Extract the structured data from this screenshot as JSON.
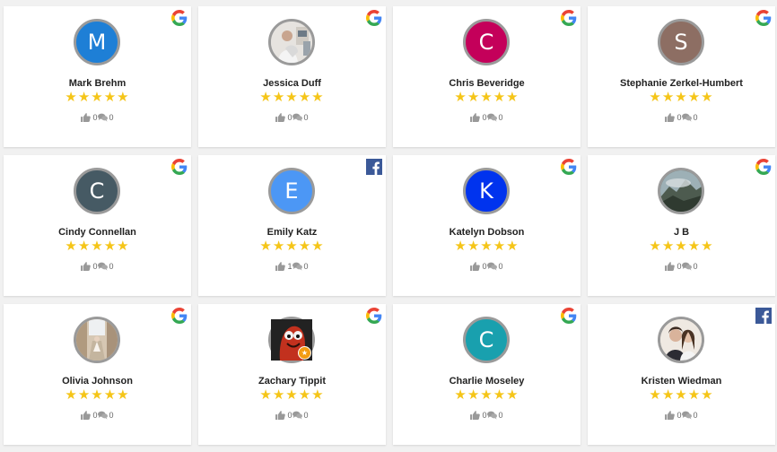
{
  "reviews": [
    {
      "name": "Mark Brehm",
      "initial": "M",
      "avatar_color": "#1e7fd6",
      "avatar_type": "letter",
      "source": "google",
      "likes": "0",
      "comments": "0"
    },
    {
      "name": "Jessica Duff",
      "initial": "",
      "avatar_color": "#c9c9c9",
      "avatar_type": "photo-room",
      "source": "google",
      "likes": "0",
      "comments": "0"
    },
    {
      "name": "Chris Beveridge",
      "initial": "C",
      "avatar_color": "#c4005a",
      "avatar_type": "letter",
      "source": "google",
      "likes": "0",
      "comments": "0"
    },
    {
      "name": "Stephanie Zerkel-Humbert",
      "initial": "S",
      "avatar_color": "#8d6e63",
      "avatar_type": "letter",
      "source": "google",
      "likes": "0",
      "comments": "0"
    },
    {
      "name": "Cindy Connellan",
      "initial": "C",
      "avatar_color": "#465a64",
      "avatar_type": "letter",
      "source": "google",
      "likes": "0",
      "comments": "0"
    },
    {
      "name": "Emily Katz",
      "initial": "E",
      "avatar_color": "#4c97f5",
      "avatar_type": "letter",
      "source": "facebook",
      "likes": "1",
      "comments": "0"
    },
    {
      "name": "Katelyn Dobson",
      "initial": "K",
      "avatar_color": "#0033ee",
      "avatar_type": "letter",
      "source": "google",
      "likes": "0",
      "comments": "0"
    },
    {
      "name": "J B",
      "initial": "",
      "avatar_color": "#5f6d63",
      "avatar_type": "photo-mountain",
      "source": "google",
      "likes": "0",
      "comments": "0"
    },
    {
      "name": "Olivia Johnson",
      "initial": "",
      "avatar_color": "#c8b6a0",
      "avatar_type": "photo-street",
      "source": "google",
      "likes": "0",
      "comments": "0"
    },
    {
      "name": "Zachary Tippit",
      "initial": "",
      "avatar_color": "#b32418",
      "avatar_type": "photo-muppet",
      "source": "google",
      "likes": "0",
      "comments": "0"
    },
    {
      "name": "Charlie Moseley",
      "initial": "C",
      "avatar_color": "#19a0ae",
      "avatar_type": "letter",
      "source": "google",
      "likes": "0",
      "comments": "0"
    },
    {
      "name": "Kristen Wiedman",
      "initial": "",
      "avatar_color": "#d8cfc4",
      "avatar_type": "photo-couple",
      "source": "facebook",
      "likes": "0",
      "comments": "0"
    }
  ],
  "rating_stars": "★★★★★",
  "colors": {
    "star": "#f5c518",
    "facebook": "#3b5998",
    "border": "#9a9a9a"
  }
}
